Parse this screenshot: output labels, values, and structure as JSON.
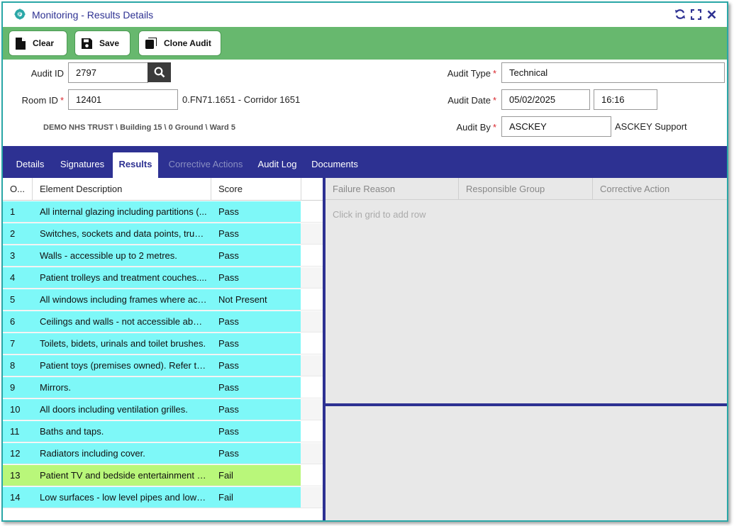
{
  "window": {
    "title": "Monitoring - Results Details"
  },
  "toolbar": {
    "clear_label": "Clear",
    "save_label": "Save",
    "clone_label": "Clone Audit"
  },
  "form": {
    "audit_id_label": "Audit ID",
    "audit_id_value": "2797",
    "room_id_label": "Room ID",
    "room_id_value": "12401",
    "room_description": "0.FN71.1651 - Corridor 1651",
    "location_path": "DEMO NHS TRUST \\ Building 15 \\ 0 Ground \\ Ward 5",
    "audit_type_label": "Audit Type",
    "audit_type_value": "Technical",
    "audit_date_label": "Audit Date",
    "audit_date_value": "05/02/2025",
    "audit_time_value": "16:16",
    "audit_by_label": "Audit By",
    "audit_by_value": "ASCKEY",
    "audit_by_name": "ASCKEY Support",
    "required_marker": "*"
  },
  "tabs": [
    {
      "label": "Details",
      "state": "normal"
    },
    {
      "label": "Signatures",
      "state": "normal"
    },
    {
      "label": "Results",
      "state": "active"
    },
    {
      "label": "Corrective Actions",
      "state": "disabled"
    },
    {
      "label": "Audit Log",
      "state": "normal"
    },
    {
      "label": "Documents",
      "state": "normal"
    }
  ],
  "results_grid": {
    "columns": [
      "O...",
      "Element Description",
      "Score"
    ],
    "rows": [
      {
        "order": "1",
        "description": "All internal glazing including partitions (...",
        "score": "Pass",
        "color": "#7ef8f8"
      },
      {
        "order": "2",
        "description": "Switches, sockets and data points, trun...",
        "score": "Pass",
        "color": "#7ef8f8"
      },
      {
        "order": "3",
        "description": "Walls - accessible up to 2 metres.",
        "score": "Pass",
        "color": "#7ef8f8"
      },
      {
        "order": "4",
        "description": "Patient trolleys and treatment couches....",
        "score": "Pass",
        "color": "#7ef8f8"
      },
      {
        "order": "5",
        "description": "All windows including frames where acc...",
        "score": "Not Present",
        "color": "#7ef8f8"
      },
      {
        "order": "6",
        "description": "Ceilings and walls - not accessible abov...",
        "score": "Pass",
        "color": "#7ef8f8"
      },
      {
        "order": "7",
        "description": "Toilets, bidets, urinals and toilet brushes.",
        "score": "Pass",
        "color": "#7ef8f8"
      },
      {
        "order": "8",
        "description": "Patient toys (premises owned). Refer to ...",
        "score": "Pass",
        "color": "#7ef8f8"
      },
      {
        "order": "9",
        "description": "Mirrors.",
        "score": "Pass",
        "color": "#7ef8f8"
      },
      {
        "order": "10",
        "description": "All doors including ventilation grilles.",
        "score": "Pass",
        "color": "#7ef8f8"
      },
      {
        "order": "11",
        "description": "Baths and taps.",
        "score": "Pass",
        "color": "#7ef8f8"
      },
      {
        "order": "12",
        "description": "Radiators including cover.",
        "score": "Pass",
        "color": "#7ef8f8"
      },
      {
        "order": "13",
        "description": "Patient TV and bedside entertainment s...",
        "score": "Fail",
        "color": "#b9f77a"
      },
      {
        "order": "14",
        "description": "Low surfaces - low level pipes and low l...",
        "score": "Fail",
        "color": "#7ef8f8"
      }
    ]
  },
  "failure_grid": {
    "columns": [
      "Failure Reason",
      "Responsible Group",
      "Corrective Action"
    ],
    "placeholder": "Click in grid to add row"
  },
  "colors": {
    "brand_navy": "#2d3192",
    "toolbar_green": "#67b86e",
    "row_pass": "#7ef8f8",
    "row_fail_highlight": "#b9f77a",
    "required": "#d9262c"
  },
  "icons": {
    "app": "gear-badge-icon",
    "refresh": "refresh-icon",
    "maximize": "maximize-icon",
    "close": "close-icon",
    "clear": "document-icon",
    "save": "floppy-disk-icon",
    "clone": "copy-icon",
    "search": "search-icon"
  }
}
